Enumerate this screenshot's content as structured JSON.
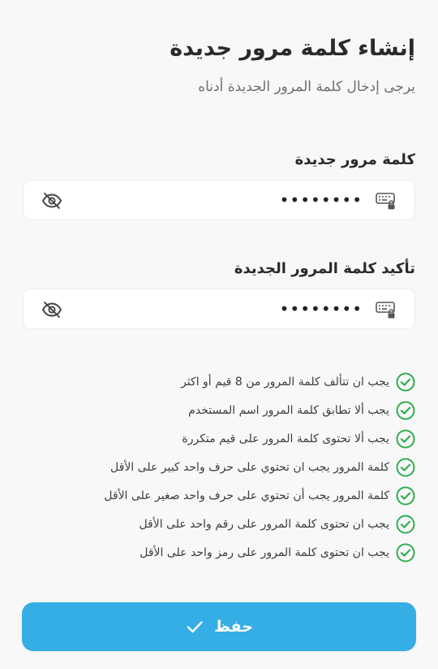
{
  "header": {
    "title": "إنشاء كلمة مرور جديدة",
    "subtitle": "يرجى إدخال كلمة المرور الجديدة أدناه"
  },
  "fields": {
    "new_password": {
      "label": "كلمة مرور جديدة",
      "value": "••••••••"
    },
    "confirm_password": {
      "label": "تأكيد كلمة المرور الجديدة",
      "value": "••••••••"
    }
  },
  "rules": [
    "يجب ان تتألف كلمة المرور من 8 قيم أو اكثر",
    "يجب ألا تطابق كلمة المرور اسم المستخدم",
    "يجب ألا تحتوى كلمة  المرور على قيم متكررة",
    "كلمة المرور يجب ان تحتوي على حرف واحد كبير على الأقل",
    "كلمة المرور يجب أن تحتوي على حرف واحد صغير على الأقل",
    "يجب ان تحتوى كلمة المرور على رقم واحد على الأقل",
    "يجب ان تحتوى كلمة المرور على رمز واحد على الأقل"
  ],
  "save_button": {
    "label": "حفظ"
  },
  "icons": {
    "key": "keyboard-lock-icon",
    "eye": "eye-off-icon",
    "check": "check-circle-icon",
    "button_check": "checkmark-icon"
  },
  "colors": {
    "accent": "#35aee5",
    "success": "#2fae4e",
    "text": "#2a2a2a",
    "muted": "#6f6f6f"
  }
}
